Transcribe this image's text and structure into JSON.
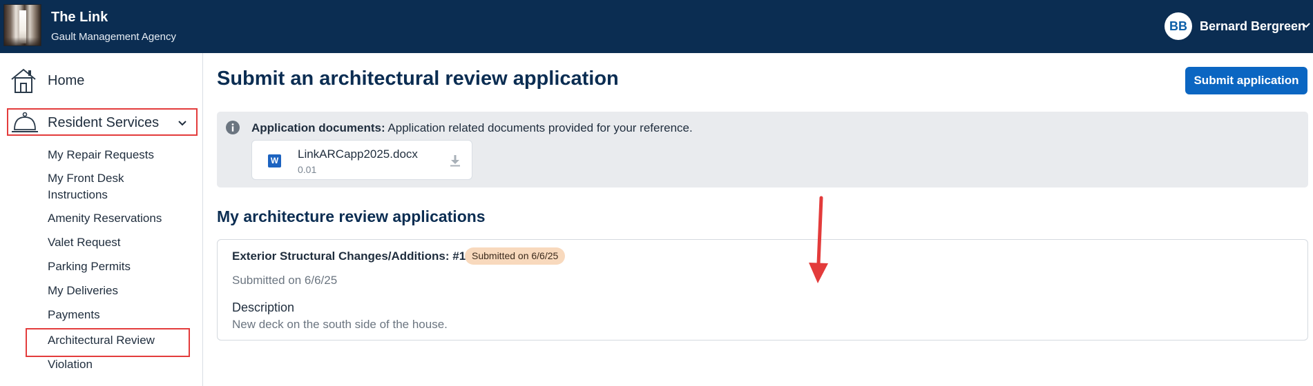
{
  "header": {
    "title": "The Link",
    "subtitle": "Gault Management Agency",
    "user": {
      "initials": "BB",
      "name": "Bernard Bergreen"
    },
    "icons": {
      "logo": "building-logo",
      "chevron": "chevron-down-icon"
    }
  },
  "sidebar": {
    "home": {
      "label": "Home",
      "icon": "home-icon"
    },
    "resident_services": {
      "label": "Resident Services",
      "icon": "concierge-bell-icon",
      "expanded": true,
      "items": [
        {
          "label": "My Repair Requests"
        },
        {
          "label": "My Front Desk Instructions"
        },
        {
          "label": "Amenity Reservations"
        },
        {
          "label": "Valet Request"
        },
        {
          "label": "Parking Permits"
        },
        {
          "label": "My Deliveries"
        },
        {
          "label": "Payments"
        },
        {
          "label": "Architectural Review"
        },
        {
          "label": "Violation"
        }
      ]
    }
  },
  "main": {
    "title": "Submit an architectural review application",
    "submit_button": "Submit application",
    "documents": {
      "label": "Application documents:",
      "text": "Application related documents provided for your reference.",
      "file": {
        "name": "LinkARCapp2025.docx",
        "size": "0.01",
        "icon": "word-doc-icon"
      }
    },
    "applications_title": "My architecture review applications",
    "applications": [
      {
        "heading": "Exterior Structural Changes/Additions: #1",
        "badge": "Submitted on 6/6/25",
        "submitted": "Submitted on 6/6/25",
        "description_label": "Description",
        "description": "New deck on the south side of the house."
      }
    ]
  },
  "colors": {
    "header_bg": "#0b2d52",
    "accent": "#0b66c2",
    "badge_bg": "#f8d9bd",
    "highlight": "#e33b3b"
  }
}
